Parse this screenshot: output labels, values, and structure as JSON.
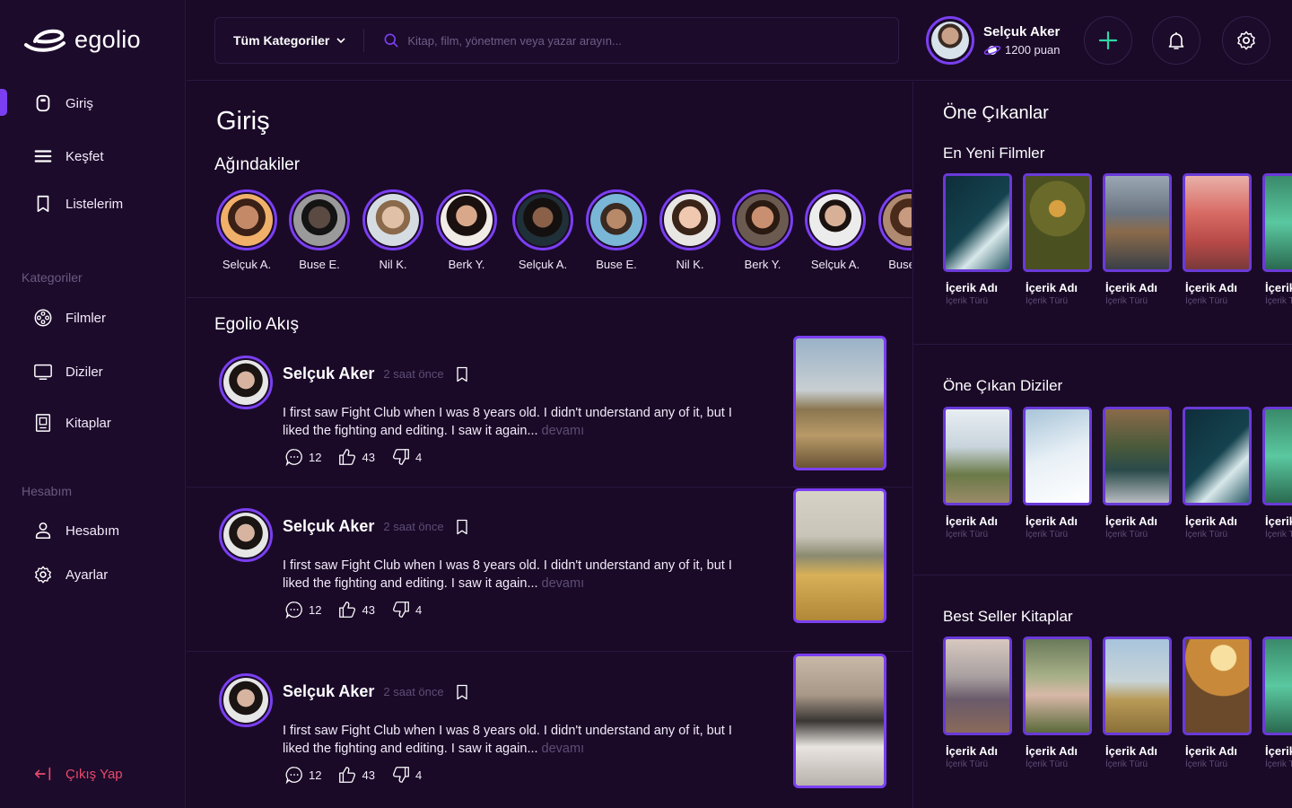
{
  "brand": {
    "name": "egolio"
  },
  "sidebar": {
    "main": [
      {
        "label": "Giriş",
        "icon": "home-icon",
        "active": true
      },
      {
        "label": "Keşfet",
        "icon": "explore-icon"
      },
      {
        "label": "Listelerim",
        "icon": "bookmark-icon"
      }
    ],
    "categories_title": "Kategoriler",
    "categories": [
      {
        "label": "Filmler",
        "icon": "film-reel-icon"
      },
      {
        "label": "Diziler",
        "icon": "tv-icon"
      },
      {
        "label": "Kitaplar",
        "icon": "book-icon"
      }
    ],
    "account_title": "Hesabım",
    "account": [
      {
        "label": "Hesabım",
        "icon": "user-icon"
      },
      {
        "label": "Ayarlar",
        "icon": "gear-icon"
      }
    ],
    "logout": "Çıkış Yap"
  },
  "topbar": {
    "category_select": "Tüm Kategoriler",
    "search_placeholder": "Kitap, film, yönetmen veya yazar arayın...",
    "user": {
      "name": "Selçuk Aker",
      "points": "1200 puan"
    }
  },
  "main": {
    "title": "Giriş",
    "network_title": "Ağındakiler",
    "friends": [
      "Selçuk A.",
      "Buse E.",
      "Nil K.",
      "Berk Y.",
      "Selçuk A.",
      "Buse E.",
      "Nil K.",
      "Berk Y.",
      "Selçuk A.",
      "Buse E."
    ],
    "feed_title": "Egolio Akış",
    "posts": [
      {
        "author": "Selçuk Aker",
        "time": "2 saat önce",
        "text": "I first saw Fight Club when I was 8 years old. I didn't understand any of it, but I liked the fighting and editing. I saw it again...",
        "more": "devamı",
        "comments": "12",
        "likes": "43",
        "dislikes": "4"
      },
      {
        "author": "Selçuk Aker",
        "time": "2 saat önce",
        "text": "I first saw Fight Club when I was 8 years old. I didn't understand any of it, but I liked the fighting and editing. I saw it again...",
        "more": "devamı",
        "comments": "12",
        "likes": "43",
        "dislikes": "4"
      },
      {
        "author": "Selçuk Aker",
        "time": "2 saat önce",
        "text": "I first saw Fight Club when I was 8 years old. I didn't understand any of it, but I liked the fighting and editing. I saw it again...",
        "more": "devamı",
        "comments": "12",
        "likes": "43",
        "dislikes": "4"
      }
    ]
  },
  "right": {
    "title": "Öne Çıkanlar",
    "groups": [
      {
        "title": "En Yeni Filmler",
        "items": [
          {
            "title": "İçerik Adı",
            "sub": "İçerik Türü"
          },
          {
            "title": "İçerik Adı",
            "sub": "İçerik Türü"
          },
          {
            "title": "İçerik Adı",
            "sub": "İçerik Türü"
          },
          {
            "title": "İçerik Adı",
            "sub": "İçerik Türü"
          },
          {
            "title": "İçerik Adı",
            "sub": "İçerik Türü"
          }
        ]
      },
      {
        "title": "Öne Çıkan Diziler",
        "items": [
          {
            "title": "İçerik Adı",
            "sub": "İçerik Türü"
          },
          {
            "title": "İçerik Adı",
            "sub": "İçerik Türü"
          },
          {
            "title": "İçerik Adı",
            "sub": "İçerik Türü"
          },
          {
            "title": "İçerik Adı",
            "sub": "İçerik Türü"
          },
          {
            "title": "İçerik Adı",
            "sub": "İçerik Türü"
          }
        ]
      },
      {
        "title": "Best Seller Kitaplar",
        "items": [
          {
            "title": "İçerik Adı",
            "sub": "İçerik Türü"
          },
          {
            "title": "İçerik Adı",
            "sub": "İçerik Türü"
          },
          {
            "title": "İçerik Adı",
            "sub": "İçerik Türü"
          },
          {
            "title": "İçerik Adı",
            "sub": "İçerik Türü"
          },
          {
            "title": "İçerik Adı",
            "sub": "İçerik Türü"
          }
        ]
      }
    ]
  },
  "colors": {
    "accent": "#7b3ff2",
    "background": "#1a0a28",
    "danger": "#e84a6a",
    "plus": "#2fd6a6"
  }
}
